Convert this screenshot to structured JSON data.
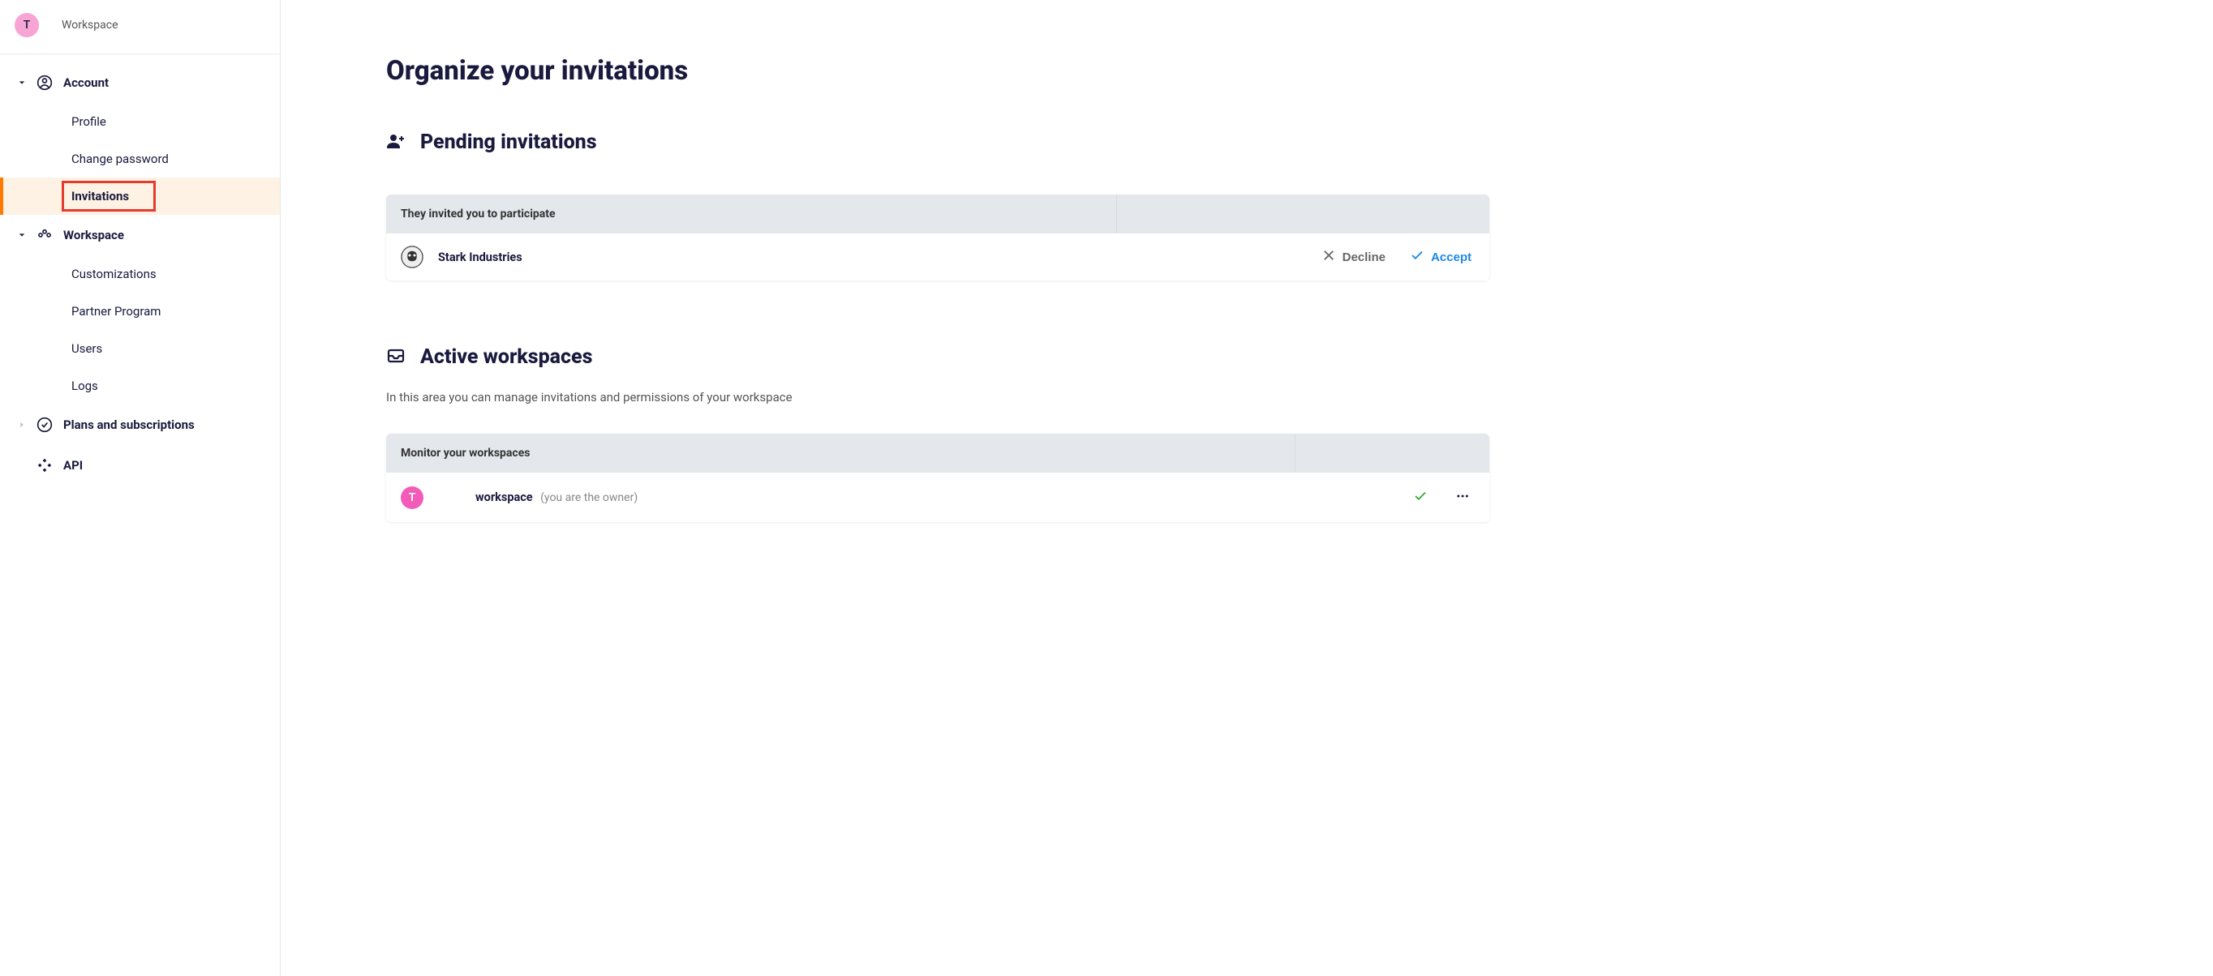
{
  "workspace": {
    "avatar_letter": "T",
    "label": "Workspace"
  },
  "sidebar": {
    "sections": [
      {
        "label": "Account",
        "expanded": true,
        "items": [
          {
            "label": "Profile",
            "active": false
          },
          {
            "label": "Change password",
            "active": false
          },
          {
            "label": "Invitations",
            "active": true
          }
        ]
      },
      {
        "label": "Workspace",
        "expanded": true,
        "items": [
          {
            "label": "Customizations"
          },
          {
            "label": "Partner Program"
          },
          {
            "label": "Users"
          },
          {
            "label": "Logs"
          }
        ]
      },
      {
        "label": "Plans and subscriptions",
        "expanded": false,
        "items": []
      },
      {
        "label": "API",
        "expanded": false,
        "items": []
      }
    ]
  },
  "page": {
    "title": "Organize your invitations"
  },
  "pending": {
    "heading": "Pending invitations",
    "table_header": "They invited you to participate",
    "rows": [
      {
        "name": "Stark Industries"
      }
    ],
    "decline_label": "Decline",
    "accept_label": "Accept"
  },
  "active": {
    "heading": "Active workspaces",
    "description": "In this area you can manage invitations and permissions of your workspace",
    "table_header": "Monitor your workspaces",
    "rows": [
      {
        "avatar_letter": "T",
        "name": "workspace",
        "suffix": "(you are the owner)"
      }
    ]
  }
}
